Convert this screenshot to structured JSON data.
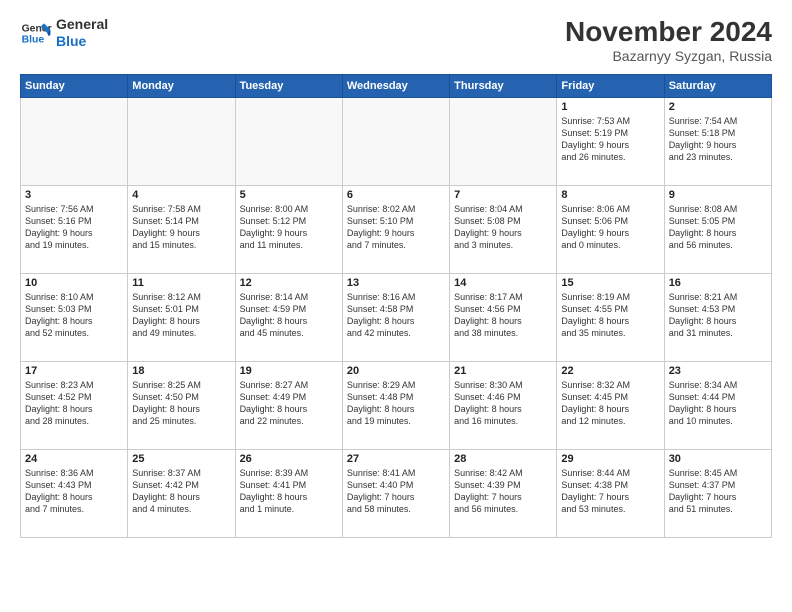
{
  "logo": {
    "line1": "General",
    "line2": "Blue"
  },
  "title": "November 2024",
  "location": "Bazarnyy Syzgan, Russia",
  "weekdays": [
    "Sunday",
    "Monday",
    "Tuesday",
    "Wednesday",
    "Thursday",
    "Friday",
    "Saturday"
  ],
  "weeks": [
    [
      {
        "day": "",
        "info": ""
      },
      {
        "day": "",
        "info": ""
      },
      {
        "day": "",
        "info": ""
      },
      {
        "day": "",
        "info": ""
      },
      {
        "day": "",
        "info": ""
      },
      {
        "day": "1",
        "info": "Sunrise: 7:53 AM\nSunset: 5:19 PM\nDaylight: 9 hours\nand 26 minutes."
      },
      {
        "day": "2",
        "info": "Sunrise: 7:54 AM\nSunset: 5:18 PM\nDaylight: 9 hours\nand 23 minutes."
      }
    ],
    [
      {
        "day": "3",
        "info": "Sunrise: 7:56 AM\nSunset: 5:16 PM\nDaylight: 9 hours\nand 19 minutes."
      },
      {
        "day": "4",
        "info": "Sunrise: 7:58 AM\nSunset: 5:14 PM\nDaylight: 9 hours\nand 15 minutes."
      },
      {
        "day": "5",
        "info": "Sunrise: 8:00 AM\nSunset: 5:12 PM\nDaylight: 9 hours\nand 11 minutes."
      },
      {
        "day": "6",
        "info": "Sunrise: 8:02 AM\nSunset: 5:10 PM\nDaylight: 9 hours\nand 7 minutes."
      },
      {
        "day": "7",
        "info": "Sunrise: 8:04 AM\nSunset: 5:08 PM\nDaylight: 9 hours\nand 3 minutes."
      },
      {
        "day": "8",
        "info": "Sunrise: 8:06 AM\nSunset: 5:06 PM\nDaylight: 9 hours\nand 0 minutes."
      },
      {
        "day": "9",
        "info": "Sunrise: 8:08 AM\nSunset: 5:05 PM\nDaylight: 8 hours\nand 56 minutes."
      }
    ],
    [
      {
        "day": "10",
        "info": "Sunrise: 8:10 AM\nSunset: 5:03 PM\nDaylight: 8 hours\nand 52 minutes."
      },
      {
        "day": "11",
        "info": "Sunrise: 8:12 AM\nSunset: 5:01 PM\nDaylight: 8 hours\nand 49 minutes."
      },
      {
        "day": "12",
        "info": "Sunrise: 8:14 AM\nSunset: 4:59 PM\nDaylight: 8 hours\nand 45 minutes."
      },
      {
        "day": "13",
        "info": "Sunrise: 8:16 AM\nSunset: 4:58 PM\nDaylight: 8 hours\nand 42 minutes."
      },
      {
        "day": "14",
        "info": "Sunrise: 8:17 AM\nSunset: 4:56 PM\nDaylight: 8 hours\nand 38 minutes."
      },
      {
        "day": "15",
        "info": "Sunrise: 8:19 AM\nSunset: 4:55 PM\nDaylight: 8 hours\nand 35 minutes."
      },
      {
        "day": "16",
        "info": "Sunrise: 8:21 AM\nSunset: 4:53 PM\nDaylight: 8 hours\nand 31 minutes."
      }
    ],
    [
      {
        "day": "17",
        "info": "Sunrise: 8:23 AM\nSunset: 4:52 PM\nDaylight: 8 hours\nand 28 minutes."
      },
      {
        "day": "18",
        "info": "Sunrise: 8:25 AM\nSunset: 4:50 PM\nDaylight: 8 hours\nand 25 minutes."
      },
      {
        "day": "19",
        "info": "Sunrise: 8:27 AM\nSunset: 4:49 PM\nDaylight: 8 hours\nand 22 minutes."
      },
      {
        "day": "20",
        "info": "Sunrise: 8:29 AM\nSunset: 4:48 PM\nDaylight: 8 hours\nand 19 minutes."
      },
      {
        "day": "21",
        "info": "Sunrise: 8:30 AM\nSunset: 4:46 PM\nDaylight: 8 hours\nand 16 minutes."
      },
      {
        "day": "22",
        "info": "Sunrise: 8:32 AM\nSunset: 4:45 PM\nDaylight: 8 hours\nand 12 minutes."
      },
      {
        "day": "23",
        "info": "Sunrise: 8:34 AM\nSunset: 4:44 PM\nDaylight: 8 hours\nand 10 minutes."
      }
    ],
    [
      {
        "day": "24",
        "info": "Sunrise: 8:36 AM\nSunset: 4:43 PM\nDaylight: 8 hours\nand 7 minutes."
      },
      {
        "day": "25",
        "info": "Sunrise: 8:37 AM\nSunset: 4:42 PM\nDaylight: 8 hours\nand 4 minutes."
      },
      {
        "day": "26",
        "info": "Sunrise: 8:39 AM\nSunset: 4:41 PM\nDaylight: 8 hours\nand 1 minute."
      },
      {
        "day": "27",
        "info": "Sunrise: 8:41 AM\nSunset: 4:40 PM\nDaylight: 7 hours\nand 58 minutes."
      },
      {
        "day": "28",
        "info": "Sunrise: 8:42 AM\nSunset: 4:39 PM\nDaylight: 7 hours\nand 56 minutes."
      },
      {
        "day": "29",
        "info": "Sunrise: 8:44 AM\nSunset: 4:38 PM\nDaylight: 7 hours\nand 53 minutes."
      },
      {
        "day": "30",
        "info": "Sunrise: 8:45 AM\nSunset: 4:37 PM\nDaylight: 7 hours\nand 51 minutes."
      }
    ]
  ]
}
